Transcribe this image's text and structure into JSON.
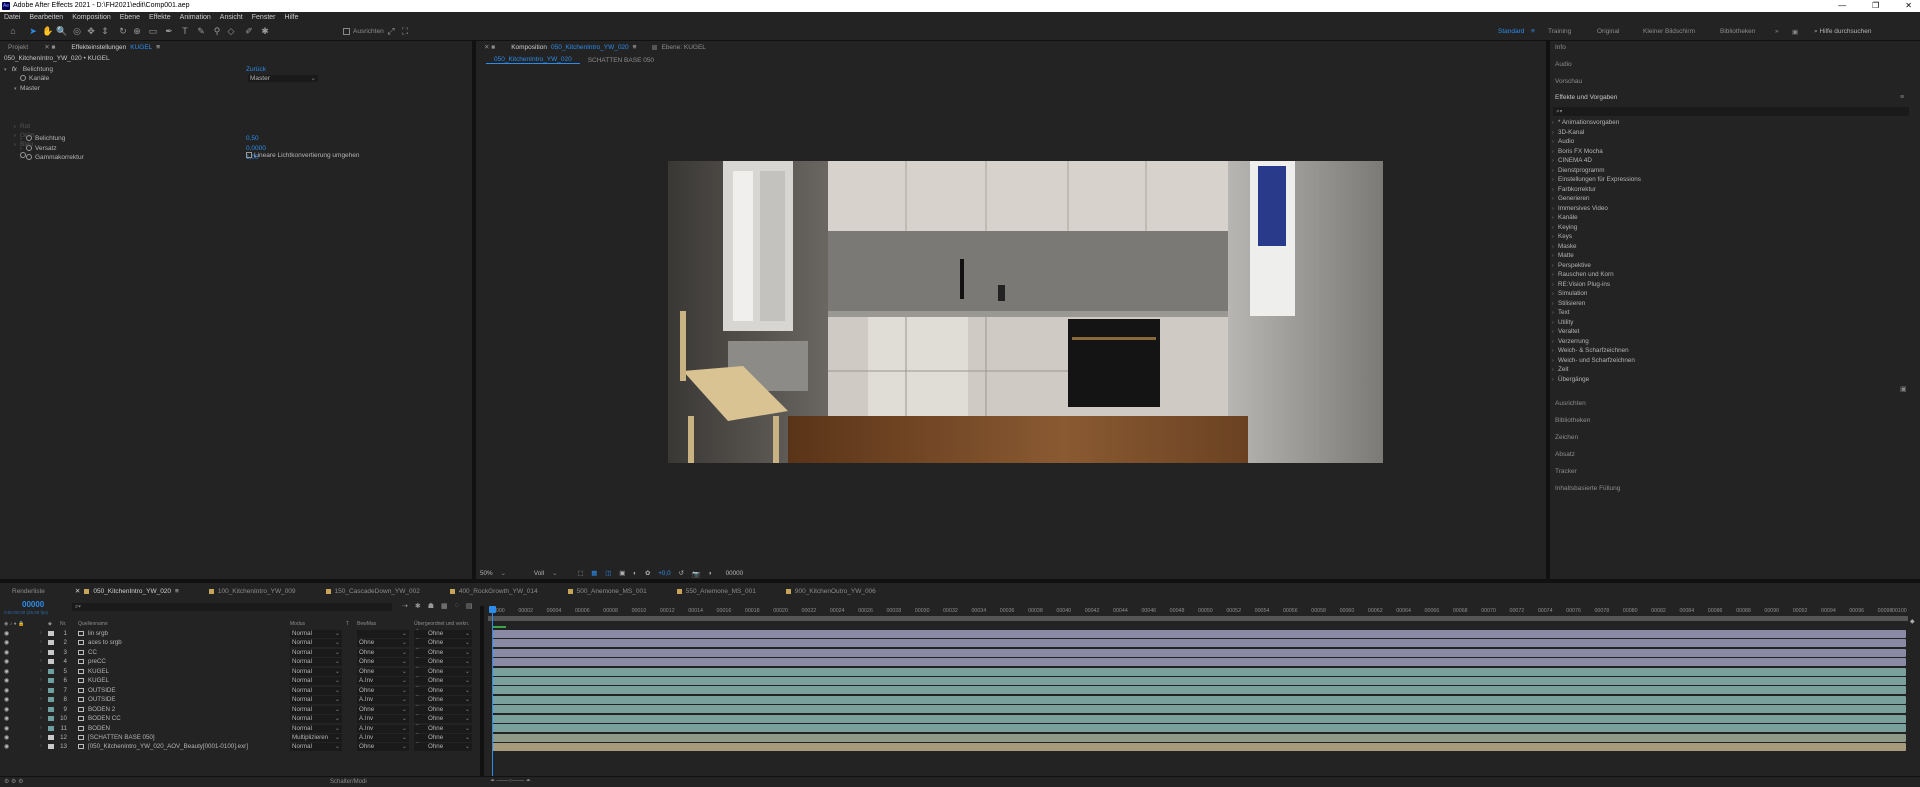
{
  "window": {
    "title": "Adobe After Effects 2021 - D:\\FH2021\\edit\\Comp001.aep",
    "app_icon": "Ae"
  },
  "menu": [
    "Datei",
    "Bearbeiten",
    "Komposition",
    "Ebene",
    "Effekte",
    "Animation",
    "Ansicht",
    "Fenster",
    "Hilfe"
  ],
  "toolbar": {
    "align_label": "Ausrichten",
    "workspaces": [
      "Standard",
      "Training",
      "Original",
      "Kleiner Bildschirm",
      "Bibliotheken"
    ],
    "search_help": "Hilfe durchsuchen"
  },
  "left_panel": {
    "tabs": [
      "Projekt",
      "Effekteinstellungen",
      "KUGEL"
    ],
    "breadcrumb": "050_KitchenIntro_YW_020 • KUGEL",
    "effect_name": "Belichtung",
    "reset_label": "Zurück",
    "channel_label": "Kanäle",
    "channel_value": "Master",
    "master_label": "Master",
    "params": [
      {
        "name": "Belichtung",
        "value": "0,50"
      },
      {
        "name": "Versatz",
        "value": "0,0000"
      },
      {
        "name": "Gammakorrektur",
        "value": "1,00"
      }
    ],
    "disabled_groups": [
      "Rot",
      "Grün",
      "Blau"
    ],
    "checkbox_label": "Lineare Lichtkonvertierung umgehen"
  },
  "comp_panel": {
    "tab_label": "Komposition",
    "comp_name": "050_KitchenIntro_YW_020",
    "footage_tab": "Ebene: KUGEL",
    "flow": [
      "050_KitchenIntro_YW_020",
      "SCHATTEN BASE 050"
    ],
    "zoom": "50%",
    "resolution": "Voll",
    "exposure": "+0,0",
    "timecode": "00000"
  },
  "right_panel": {
    "collapsed_top": [
      "Info",
      "Audio",
      "Vorschau"
    ],
    "effects_title": "Effekte und Vorgaben",
    "categories": [
      "* Animationsvorgaben",
      "3D-Kanal",
      "Audio",
      "Boris FX Mocha",
      "CINEMA 4D",
      "Dienstprogramm",
      "Einstellungen für Expressions",
      "Farbkorrektur",
      "Generieren",
      "Immersives Video",
      "Kanäle",
      "Keying",
      "Keys",
      "Maske",
      "Matte",
      "Perspektive",
      "Rauschen und Korn",
      "RE:Vision Plug-ins",
      "Simulation",
      "Stilisieren",
      "Text",
      "Utility",
      "Veraltet",
      "Verzerrung",
      "Weich- & Scharfzeichnen",
      "Weich- und Scharfzeichnen",
      "Zeit",
      "Übergänge"
    ],
    "collapsed_bottom": [
      "Ausrichten",
      "Bibliotheken",
      "Zeichen",
      "Absatz",
      "Tracker",
      "Inhaltsbasierte Füllung"
    ]
  },
  "timeline": {
    "tabs": [
      "Renderliste",
      "050_KitchenIntro_YW_020",
      "100_KitchenIntro_YW_009",
      "150_CascadeDown_YW_002",
      "400_RockGrowth_YW_014",
      "500_Anemone_MS_001",
      "550_Anemone_MS_001",
      "900_KitchenOutro_YW_006"
    ],
    "timecode": "00000",
    "sub_timecode": "0:00:00:00 (25.00 fps)",
    "headers": {
      "num": "Nr.",
      "source": "Quellenname",
      "mode": "Modus",
      "t": "T",
      "track": "BewMas",
      "parent": "Übergeordnet und verkn."
    },
    "layers": [
      {
        "num": "1",
        "name": "lin srgb",
        "mode": "Normal",
        "track": "",
        "parent": "Ohne",
        "color": "#c8c8c8",
        "bar": "#8a8aa4"
      },
      {
        "num": "2",
        "name": "aces to srgb",
        "mode": "Normal",
        "track": "Ohne",
        "parent": "Ohne",
        "color": "#c8c8c8",
        "bar": "#8a8aa4"
      },
      {
        "num": "3",
        "name": "CC",
        "mode": "Normal",
        "track": "Ohne",
        "parent": "Ohne",
        "color": "#c8c8c8",
        "bar": "#8a8aa4"
      },
      {
        "num": "4",
        "name": "preCC",
        "mode": "Normal",
        "track": "Ohne",
        "parent": "Ohne",
        "color": "#c8c8c8",
        "bar": "#8a8aa4"
      },
      {
        "num": "5",
        "name": "KUGEL",
        "mode": "Normal",
        "track": "Ohne",
        "parent": "Ohne",
        "color": "#6fa0a0",
        "bar": "#7aa09c"
      },
      {
        "num": "6",
        "name": "KUGEL",
        "mode": "Normal",
        "track": "A.Inv",
        "parent": "Ohne",
        "color": "#6fa0a0",
        "bar": "#7aa09c"
      },
      {
        "num": "7",
        "name": "OUTSIDE",
        "mode": "Normal",
        "track": "Ohne",
        "parent": "Ohne",
        "color": "#6fa0a0",
        "bar": "#7aa09c"
      },
      {
        "num": "8",
        "name": "OUTSIDE",
        "mode": "Normal",
        "track": "A.Inv",
        "parent": "Ohne",
        "color": "#6fa0a0",
        "bar": "#7aa09c"
      },
      {
        "num": "9",
        "name": "BODEN 2",
        "mode": "Normal",
        "track": "Ohne",
        "parent": "Ohne",
        "color": "#6fa0a0",
        "bar": "#7aa09c"
      },
      {
        "num": "10",
        "name": "BODEN CC",
        "mode": "Normal",
        "track": "A.Inv",
        "parent": "Ohne",
        "color": "#6fa0a0",
        "bar": "#7aa09c"
      },
      {
        "num": "11",
        "name": "BODEN",
        "mode": "Normal",
        "track": "A.Inv",
        "parent": "Ohne",
        "color": "#6fa0a0",
        "bar": "#7aa09c"
      },
      {
        "num": "12",
        "name": "[SCHATTEN BASE 050]",
        "mode": "Multiplizieren",
        "track": "A.Inv",
        "parent": "Ohne",
        "color": "#c8c8c8",
        "bar": "#8f9a86"
      },
      {
        "num": "13",
        "name": "[050_KitchenIntro_YW_020_AOV_Beauty[0001-0100].exr]",
        "mode": "Normal",
        "track": "Ohne",
        "parent": "Ohne",
        "color": "#c8c8c8",
        "bar": "#a59a7c"
      }
    ],
    "ruler": [
      "00000",
      "00002",
      "00004",
      "00006",
      "00008",
      "00010",
      "00012",
      "00014",
      "00016",
      "00018",
      "00020",
      "00022",
      "00024",
      "00026",
      "00028",
      "00030",
      "00032",
      "00034",
      "00036",
      "00038",
      "00040",
      "00042",
      "00044",
      "00046",
      "00048",
      "00050",
      "00052",
      "00054",
      "00056",
      "00058",
      "00060",
      "00062",
      "00064",
      "00066",
      "00068",
      "00070",
      "00072",
      "00074",
      "00076",
      "00078",
      "00080",
      "00082",
      "00084",
      "00086",
      "00088",
      "00090",
      "00092",
      "00094",
      "00096",
      "00098",
      "00100"
    ],
    "footer_label": "Schalter/Modi"
  }
}
